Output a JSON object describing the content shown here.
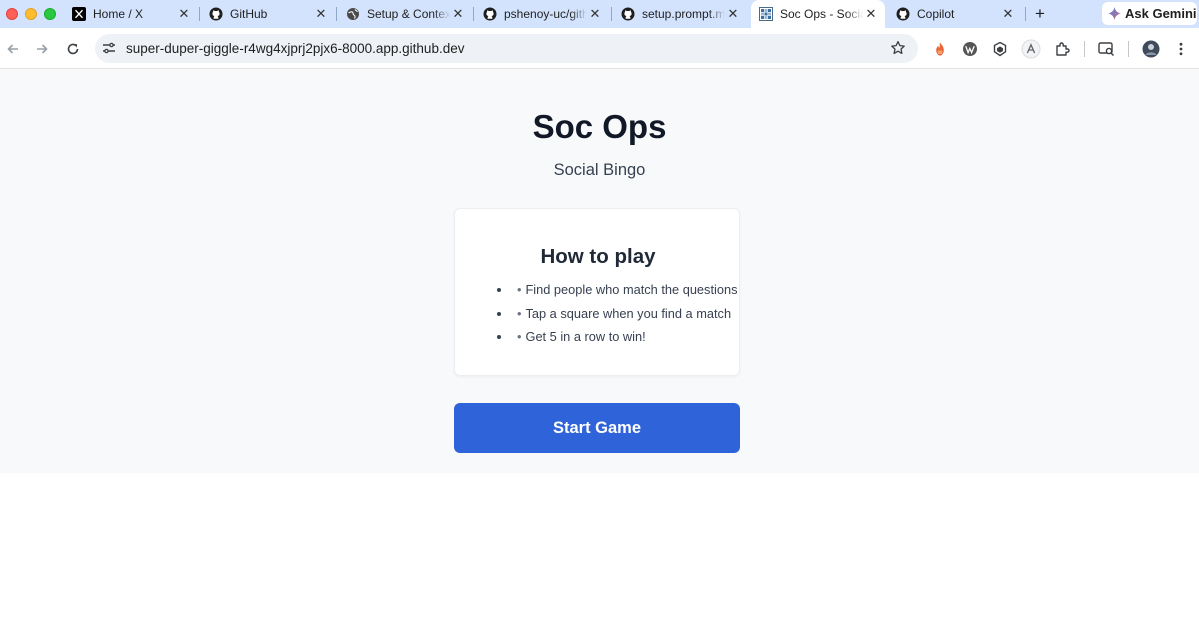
{
  "browser": {
    "tabs": [
      {
        "label": "Home / X",
        "icon": "x-logo-icon",
        "active": false
      },
      {
        "label": "GitHub",
        "icon": "github-icon",
        "active": false
      },
      {
        "label": "Setup & Context",
        "icon": "globe-icon",
        "active": false
      },
      {
        "label": "pshenoy-uc/github",
        "icon": "github-icon",
        "active": false
      },
      {
        "label": "setup.prompt.md",
        "icon": "github-icon",
        "active": false
      },
      {
        "label": "Soc Ops - Social Bingo",
        "icon": "grid-favicon-icon",
        "active": true
      },
      {
        "label": "Copilot",
        "icon": "github-icon",
        "active": false
      }
    ],
    "new_tab_label": "+",
    "gemini_label": "Ask Gemini",
    "url": "super-duper-giggle-r4wg4xjprj2pjx6-8000.app.github.dev",
    "accent_color": "#d3e3fd"
  },
  "app": {
    "title": "Soc Ops",
    "subtitle": "Social Bingo",
    "how_to_play": {
      "heading": "How to play",
      "bullet_glyph": "•",
      "rules": [
        "Find people who match the questions",
        "Tap a square when you find a match",
        "Get 5 in a row to win!"
      ]
    },
    "start_button_label": "Start Game",
    "button_color": "#2f63d9"
  }
}
